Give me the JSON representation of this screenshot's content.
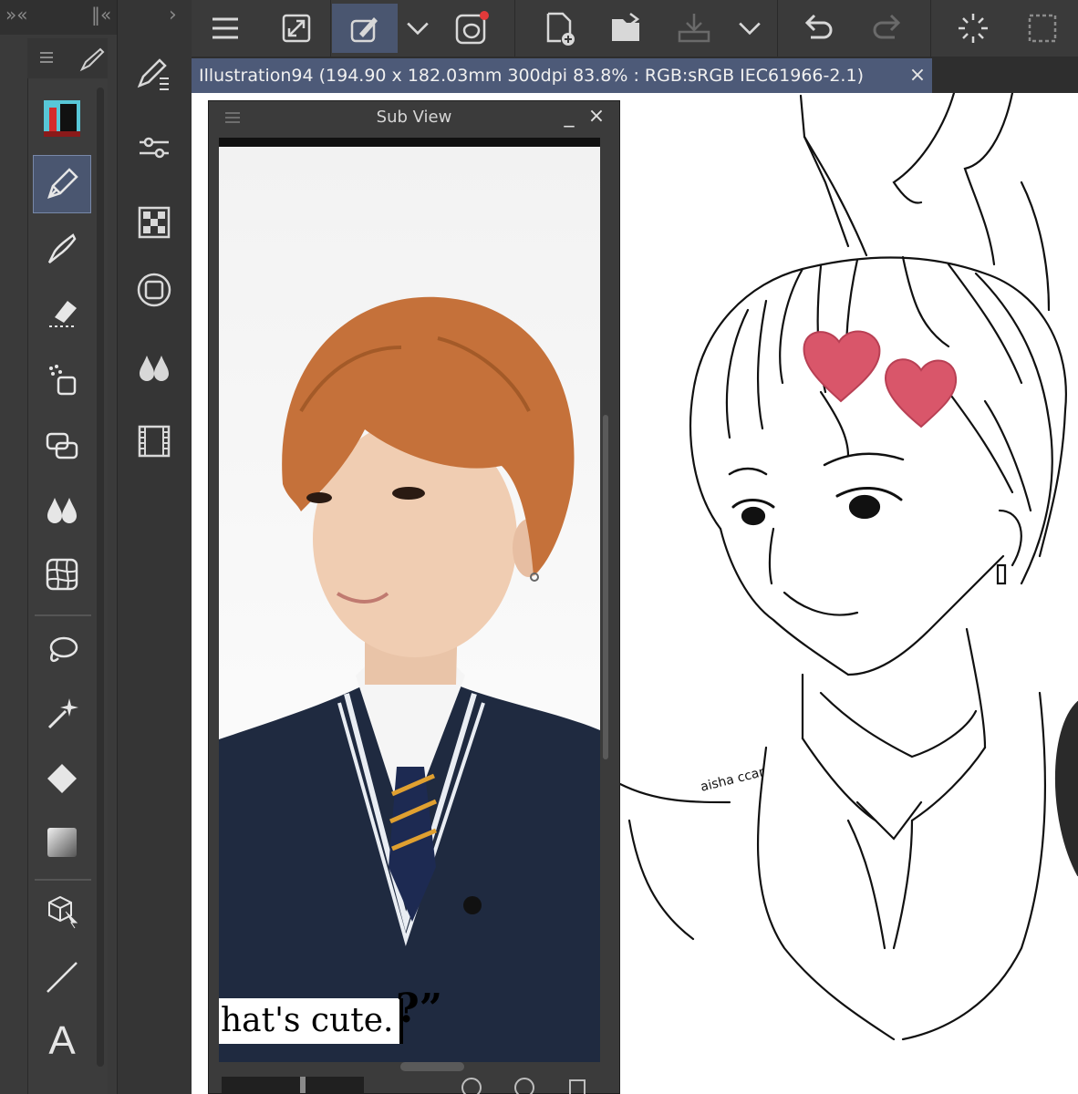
{
  "document": {
    "tab_title": "Illustration94 (194.90 x 182.03mm 300dpi 83.8% : RGB:sRGB IEC61966-2.1)",
    "close_glyph": "×"
  },
  "subview": {
    "title": "Sub View",
    "minimize_glyph": "_",
    "close_glyph": "×",
    "caption_text": "hat's cute.",
    "caption_suffix": "?”"
  },
  "toolbar": {
    "collapse_left": "»«",
    "collapse_right": "‖«",
    "expand": "›"
  },
  "tools": [
    "color-swatch",
    "pen",
    "brush",
    "eraser",
    "airbrush",
    "blend",
    "fill-drops",
    "mesh",
    "lasso",
    "magic-wand",
    "fill-bucket",
    "gradient",
    "3d-move",
    "line",
    "text"
  ],
  "text_tool_label": "A",
  "colors": {
    "panel": "#3a3a3a",
    "active": "#4a5670",
    "tab": "#4d5a78",
    "heart": "#d9566a",
    "hair": "#c5713a",
    "sweater": "#1f2a40"
  }
}
